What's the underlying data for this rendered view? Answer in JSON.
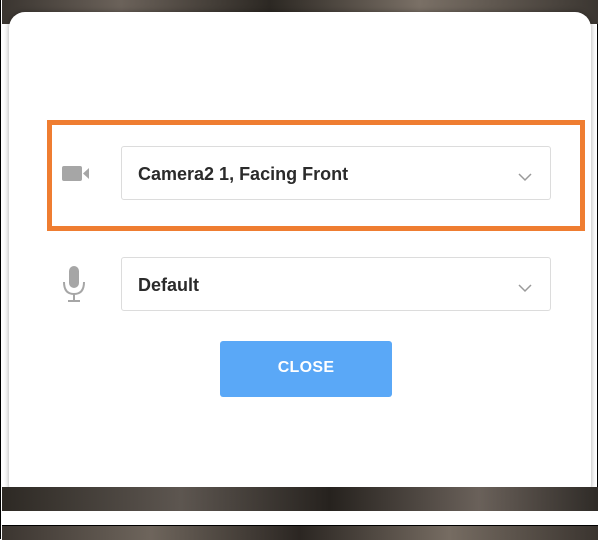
{
  "dialog": {
    "camera": {
      "icon": "video-camera-icon",
      "selected": "Camera2 1, Facing Front"
    },
    "microphone": {
      "icon": "microphone-icon",
      "selected": "Default"
    },
    "close_label": "CLOSE"
  },
  "colors": {
    "highlight": "#ef7d31",
    "button": "#5aa8f7",
    "icon": "#a6a6a6"
  }
}
